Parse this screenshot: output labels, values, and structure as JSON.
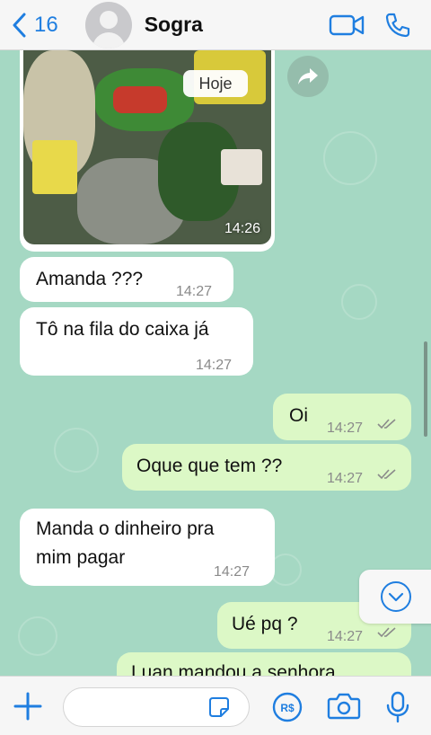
{
  "header": {
    "back_count": "16",
    "contact_name": "Sogra"
  },
  "chat": {
    "date_separator": "Hoje",
    "image_message": {
      "time": "14:26"
    },
    "messages": [
      {
        "dir": "in",
        "text": "Amanda ???",
        "time": "14:27"
      },
      {
        "dir": "in",
        "text": "Tô na fila do caixa já",
        "time": "14:27"
      },
      {
        "dir": "out",
        "text": "Oi",
        "time": "14:27"
      },
      {
        "dir": "out",
        "text": "Oque que tem ??",
        "time": "14:27"
      },
      {
        "dir": "in",
        "text": "Manda o dinheiro pra",
        "text2": "mim pagar",
        "time": "14:27"
      },
      {
        "dir": "out",
        "text": "Ué pq ?",
        "time": "14:27"
      },
      {
        "dir": "out",
        "text": "Luan mandou a senhora",
        "time": ""
      }
    ]
  },
  "composer": {
    "placeholder": ""
  },
  "colors": {
    "accent": "#1f7ee0",
    "outgoing": "#dcf8c6",
    "incoming": "#ffffff",
    "wallpaper": "#a5d8c3"
  },
  "icons": [
    "chevron-left-icon",
    "video-icon",
    "phone-icon",
    "forward-icon",
    "chevron-down-icon",
    "plus-icon",
    "sticker-icon",
    "payment-icon",
    "camera-icon",
    "microphone-icon",
    "read-ticks-icon"
  ]
}
